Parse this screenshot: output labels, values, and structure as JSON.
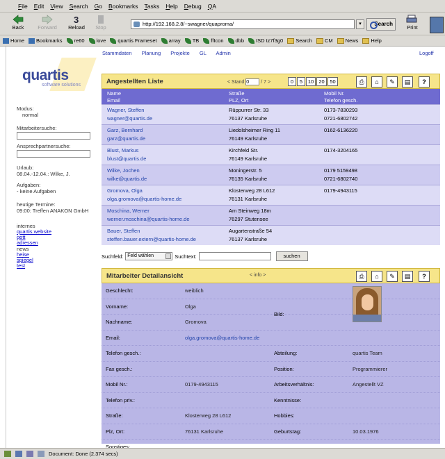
{
  "browser": {
    "menu": [
      "File",
      "Edit",
      "View",
      "Search",
      "Go",
      "Bookmarks",
      "Tasks",
      "Help",
      "Debug",
      "QA"
    ],
    "nav": {
      "back": "Back",
      "forward": "Forward",
      "reload": "Reload",
      "stop": "Stop",
      "search": "Search",
      "print": "Print"
    },
    "url": "http://192.168.2.8/~swagner/quaproma/",
    "bookmarks": [
      "Home",
      "Bookmarks",
      "re60",
      "love",
      "quartis Frameset",
      "array",
      "TB",
      "ffIcon",
      "dbb",
      "ISD tz7f3g0",
      "Search",
      "CM",
      "News",
      "Help"
    ],
    "status": "Document: Done (2.374 secs)"
  },
  "left": {
    "logo": "quartis",
    "logo_sub": "software solutions",
    "modus_label": "Modus:",
    "modus_value": "normal",
    "mitarbeitersuche": "Mitarbeitersuche:",
    "ansprechpartnersuche": "Ansprechpartnersuche:",
    "urlaub_label": "Urlaub:",
    "urlaub_value": "08.04.-12.04.: Wilke, J.",
    "aufgaben_label": "Aufgaben:",
    "aufgaben_value": "- keine Aufgaben",
    "termine_label": "heutige Termine:",
    "termine_value": "09:00: Treffen ANAKON GmbH",
    "internes_label": "internes",
    "internes_links": [
      "quartis website",
      "qott",
      "adressen"
    ],
    "news_label": "news",
    "news_links": [
      "heise",
      "spiegel",
      "test"
    ]
  },
  "topnav": {
    "items": [
      "Stammdaten",
      "Planung",
      "Projekte",
      "GL",
      "Admin"
    ],
    "logoff": "Logoff"
  },
  "list": {
    "title": "Angestellten Liste",
    "pager_prefix": "< Stand",
    "pager_value": "0",
    "pager_suffix": "/ 7 >",
    "page_sizes": [
      "0",
      "5",
      "10",
      "20",
      "50"
    ],
    "columns": {
      "c1a": "Name",
      "c1b": "Email",
      "c2a": "Straße",
      "c2b": "PLZ, Ort",
      "c3a": "Mobil Nr.",
      "c3b": "Telefon gesch."
    },
    "rows": [
      {
        "name": "Wagner, Steffen",
        "email": "wagner@quartis.de",
        "strasse": "Rüppurrer Str. 33",
        "ort": "76137 Karlsruhe",
        "mobil": "0173-7830293",
        "tel": "0721-6802742"
      },
      {
        "name": "Garz, Bernhard",
        "email": "garz@quartis.de",
        "strasse": "Liedolsheimer Ring 11",
        "ort": "76149 Karlsruhe",
        "mobil": "0162-6136220",
        "tel": ""
      },
      {
        "name": "Blust, Markus",
        "email": "blust@quartis.de",
        "strasse": "Kirchfeld Str.",
        "ort": "76149 Karlsruhe",
        "mobil": "0174-3204165",
        "tel": ""
      },
      {
        "name": "Wilke, Jochen",
        "email": "wilke@quartis.de",
        "strasse": "Moningerstr. 5",
        "ort": "76135 Karlsruhe",
        "mobil": "0179 5159498",
        "tel": "0721-6802740"
      },
      {
        "name": "Gromova, Olga",
        "email": "olga.gromova@quartis-home.de",
        "strasse": "Klosterweg 28 L612",
        "ort": "76131 Karlsruhe",
        "mobil": "0179-4943115",
        "tel": ""
      },
      {
        "name": "Moschina, Werner",
        "email": "werner.moschina@quartis-home.de",
        "strasse": "Am Steinweg 18m",
        "ort": "76297 Stutensee",
        "mobil": "",
        "tel": ""
      },
      {
        "name": "Bauer, Steffen",
        "email": "steffen.bauer.extern@quartis-home.de",
        "strasse": "Augartenstraße 54",
        "ort": "76137 Karlsruhe",
        "mobil": "",
        "tel": ""
      }
    ],
    "suchfeld_label": "Suchfeld:",
    "suchfeld_select": "Feld wählen",
    "suchtext_label": "Suchtext:",
    "suchen": "suchen"
  },
  "detail": {
    "title": "Mitarbeiter Detailansicht",
    "info": "< info >",
    "left_rows": [
      {
        "label": "Geschlecht:",
        "value": "weiblich"
      },
      {
        "label": "Vorname:",
        "value": "Olga"
      },
      {
        "label": "Nachname:",
        "value": "Gromova"
      },
      {
        "label": "Email:",
        "value": "olga.gromova@quartis-home.de"
      },
      {
        "label": "Telefon gesch.:",
        "value": ""
      },
      {
        "label": "Fax gesch.:",
        "value": ""
      },
      {
        "label": "Mobil Nr.:",
        "value": "0179-4943115"
      },
      {
        "label": "Telefon priv.:",
        "value": ""
      },
      {
        "label": "Straße:",
        "value": "Klosterweg 28 L612"
      },
      {
        "label": "Plz, Ort:",
        "value": "76131 Karlsruhe"
      },
      {
        "label": "Sonstiges:",
        "value": ""
      }
    ],
    "bild_label": "Bild:",
    "right_rows": [
      {
        "label": "Abteilung:",
        "value": "quartis Team"
      },
      {
        "label": "Position:",
        "value": "Programmierer"
      },
      {
        "label": "Arbeitsverhältnis:",
        "value": "Angestellt VZ"
      },
      {
        "label": "Kenntnisse:",
        "value": ""
      },
      {
        "label": "Hobbies:",
        "value": ""
      },
      {
        "label": "Geburtstag:",
        "value": "10.03.1976"
      }
    ]
  },
  "colors": {
    "panel_header": "#f6e58a",
    "panel_body": "#b9b6e6",
    "col_header": "#6f6bd0",
    "link": "#2244aa"
  }
}
